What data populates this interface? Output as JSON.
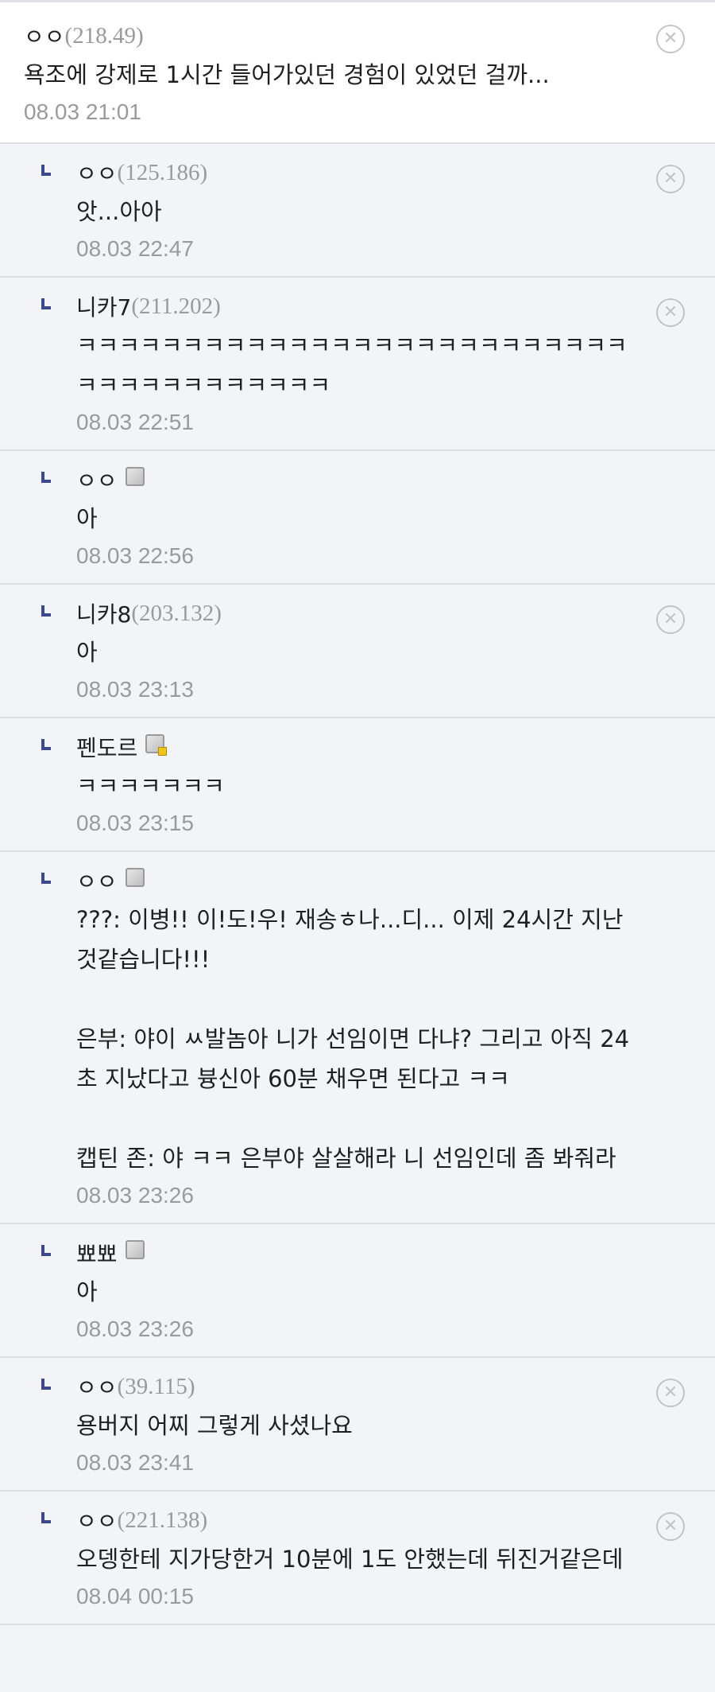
{
  "comments": [
    {
      "nick": "ㅇㅇ",
      "ip": "(218.49)",
      "fixed": false,
      "body": "욕조에 강제로 1시간 들어가있던 경험이 있었던 걸까...",
      "date": "08.03 21:01",
      "reply": false,
      "deletable": true
    },
    {
      "nick": "ㅇㅇ",
      "ip": "(125.186)",
      "fixed": false,
      "body": "앗...아아",
      "date": "08.03 22:47",
      "reply": true,
      "deletable": true
    },
    {
      "nick": "니카7",
      "ip": "(211.202)",
      "fixed": false,
      "body": "ㅋㅋㅋㅋㅋㅋㅋㅋㅋㅋㅋㅋㅋㅋㅋㅋㅋㅋㅋㅋㅋㅋㅋㅋㅋㅋㅋㅋㅋㅋㅋㅋㅋㅋㅋㅋㅋㅋ",
      "date": "08.03 22:51",
      "reply": true,
      "deletable": true
    },
    {
      "nick": "ㅇㅇ",
      "ip": "",
      "fixed": true,
      "gold": false,
      "body": "아",
      "date": "08.03 22:56",
      "reply": true,
      "deletable": false
    },
    {
      "nick": "니카8",
      "ip": "(203.132)",
      "fixed": false,
      "body": "아",
      "date": "08.03 23:13",
      "reply": true,
      "deletable": true
    },
    {
      "nick": "펜도르",
      "ip": "",
      "fixed": true,
      "gold": true,
      "body": "ㅋㅋㅋㅋㅋㅋㅋ",
      "date": "08.03 23:15",
      "reply": true,
      "deletable": false
    },
    {
      "nick": "ㅇㅇ",
      "ip": "",
      "fixed": true,
      "gold": false,
      "body": "???: 이병!! 이!도!우! 재송ㅎ나...디... 이제 24시간 지난것같습니다!!!\n\n은부: 야이 ㅆ발놈아 니가 선임이면 다냐? 그리고 아직 24초 지났다고 븅신아 60분 채우면 된다고 ㅋㅋ\n\n캡틴 존: 야 ㅋㅋ 은부야 살살해라 니 선임인데 좀 봐줘라",
      "date": "08.03 23:26",
      "reply": true,
      "deletable": false
    },
    {
      "nick": "뾰뾰",
      "ip": "",
      "fixed": true,
      "gold": false,
      "body": "아",
      "date": "08.03 23:26",
      "reply": true,
      "deletable": false
    },
    {
      "nick": "ㅇㅇ",
      "ip": "(39.115)",
      "fixed": false,
      "body": "용버지 어찌 그렇게 사셨나요",
      "date": "08.03 23:41",
      "reply": true,
      "deletable": true
    },
    {
      "nick": "ㅇㅇ",
      "ip": "(221.138)",
      "fixed": false,
      "body": "오뎅한테 지가당한거 10분에 1도 안했는데 뒤진거같은데",
      "date": "08.04 00:15",
      "reply": true,
      "deletable": true
    }
  ],
  "icons": {
    "delete": "close-circle-icon",
    "reply": "reply-arrow-icon",
    "fixed_nick": "fixed-nickname-icon"
  },
  "colors": {
    "reply_mark": "#3b4890",
    "meta": "#9a9a9a",
    "bg_reply": "#f3f4f8",
    "bg_top": "#ffffff"
  }
}
